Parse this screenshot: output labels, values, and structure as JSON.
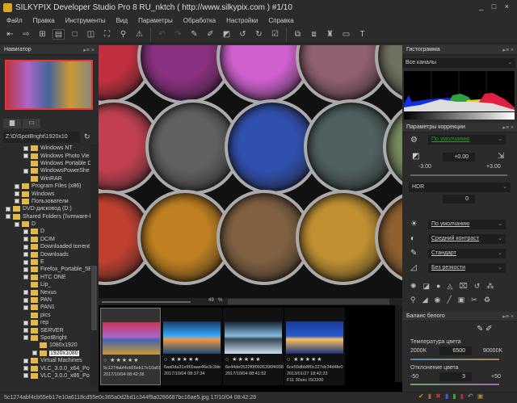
{
  "window": {
    "title": "SILKYPIX Developer Studio Pro 8 RU_nktch ( http://www.silkypix.com )  #1/10",
    "controls": "_ □ ×"
  },
  "menu": [
    "Файл",
    "Правка",
    "Инструменты",
    "Вид",
    "Параметры",
    "Обработка",
    "Настройки",
    "Справка"
  ],
  "toolbar": {
    "icons": [
      "develop-icon",
      "next-icon",
      "thumbnails-icon",
      "preview-filmstrip-icon",
      "single-view-icon",
      "compare-icon",
      "fullscreen-icon",
      "zoom-icon",
      "warning-icon",
      "undo-icon",
      "redo-icon",
      "paste-params-icon",
      "copy-params-icon",
      "default-params-icon",
      "rotate-left-icon",
      "rotate-right-icon",
      "check-icon",
      "develop-batch-icon",
      "develop-disabled-icon",
      "stamp-icon",
      "monitor-icon",
      "hammer-icon"
    ]
  },
  "navigator": {
    "title": "Навигатор"
  },
  "browser": {
    "path": "Z:\\D\\SpotBright\\1920x10",
    "tree": [
      {
        "label": "Windows NT",
        "indent": 3,
        "exp": true
      },
      {
        "label": "Windows Photo Vie",
        "indent": 3,
        "exp": true
      },
      {
        "label": "Windows Portable D",
        "indent": 3,
        "exp": false
      },
      {
        "label": "WindowsPowerShe",
        "indent": 3,
        "exp": true
      },
      {
        "label": "WinRAR",
        "indent": 3,
        "exp": false
      },
      {
        "label": "Program Files (x86)",
        "indent": 2,
        "exp": true
      },
      {
        "label": "Windows",
        "indent": 2,
        "exp": true
      },
      {
        "label": "Пользователи",
        "indent": 2,
        "exp": true
      },
      {
        "label": "DVD-дисковод (D:)",
        "indent": 1,
        "exp": true
      },
      {
        "label": "Shared Folders (\\\\vmware-h",
        "indent": 1,
        "exp": true
      },
      {
        "label": "D",
        "indent": 2,
        "exp": true
      },
      {
        "label": "D",
        "indent": 3,
        "exp": true
      },
      {
        "label": "DCIM",
        "indent": 3,
        "exp": true
      },
      {
        "label": "Downloaded torrent",
        "indent": 3,
        "exp": true
      },
      {
        "label": "Downloads",
        "indent": 3,
        "exp": true
      },
      {
        "label": "E",
        "indent": 3,
        "exp": true
      },
      {
        "label": "Firefox_Portable_5E",
        "indent": 3,
        "exp": true
      },
      {
        "label": "HTC ONE",
        "indent": 3,
        "exp": true
      },
      {
        "label": "Lip_",
        "indent": 3,
        "exp": false
      },
      {
        "label": "Nexus",
        "indent": 3,
        "exp": true
      },
      {
        "label": "PAN",
        "indent": 3,
        "exp": true
      },
      {
        "label": "PAN1",
        "indent": 3,
        "exp": true
      },
      {
        "label": "pics",
        "indent": 3,
        "exp": false
      },
      {
        "label": "rep",
        "indent": 3,
        "exp": true
      },
      {
        "label": "SERVER",
        "indent": 3,
        "exp": true
      },
      {
        "label": "SpotBright",
        "indent": 3,
        "exp": true
      },
      {
        "label": "1080x1920",
        "indent": 4,
        "exp": false
      },
      {
        "label": "1920x1080",
        "indent": 4,
        "exp": true,
        "selected": true
      },
      {
        "label": "Virtual Machines",
        "indent": 3,
        "exp": true
      },
      {
        "label": "VLC_3.0.0_x64_Po",
        "indent": 3,
        "exp": true
      },
      {
        "label": "VLC_3.0.0_x86_Po",
        "indent": 3,
        "exp": true
      }
    ]
  },
  "zoom": {
    "value": "49",
    "unit": "%"
  },
  "filmstrip": [
    {
      "name": "5c1274abf4cb55eb17e10a61",
      "date": "2017/10/04 08:42:28",
      "selected": true,
      "colors": [
        "#c35",
        "#a6c",
        "#46a",
        "#c93"
      ]
    },
    {
      "name": "6aa0da31e965aae46e3c3de",
      "date": "2017/10/04 08:37:34",
      "colors": [
        "#1a3a6a",
        "#3af",
        "#e94",
        "#1a4a7a"
      ]
    },
    {
      "name": "6e44de0522f0f0926396f4938",
      "date": "2017/10/04 08:41:52",
      "colors": [
        "#123",
        "#8bd",
        "#345",
        "#cde"
      ]
    },
    {
      "name": "6ce59dbb8f0c327dc34d4fe0",
      "date": "2013/01/27 18:42:23",
      "extra": "F11 30sec ISO200",
      "colors": [
        "#1a3a9a",
        "#2a5acc",
        "#f8c060",
        "#1a3080"
      ]
    }
  ],
  "status": "5c1274abf4cb55eb17e10a6118cd55e0c365a0d2bd1c344f9a0286687bc16ae5.jpg 17/10/04 08:42:28",
  "histogram": {
    "title": "Гистограмма",
    "channel": "Все каналы"
  },
  "correction": {
    "title": "Параметры коррекции",
    "preset": "По умолчанию",
    "exposure": "+0.00",
    "exp_min": "-3.00",
    "exp_max": "+3.00",
    "hdr_label": "HDR",
    "hdr": "0",
    "tone": "По умолчанию",
    "contrast": "Средний контраст",
    "color": "Стандарт",
    "sharpness": "Без резкости"
  },
  "wb": {
    "title": "Баланс белого",
    "temp_label": "Температура цвета",
    "temp_min": "2000K",
    "temp": "6500",
    "temp_max": "90000K",
    "dev_label": "Отклонение цвета",
    "dev_min": "-50",
    "dev": "3",
    "dev_max": "+50"
  }
}
